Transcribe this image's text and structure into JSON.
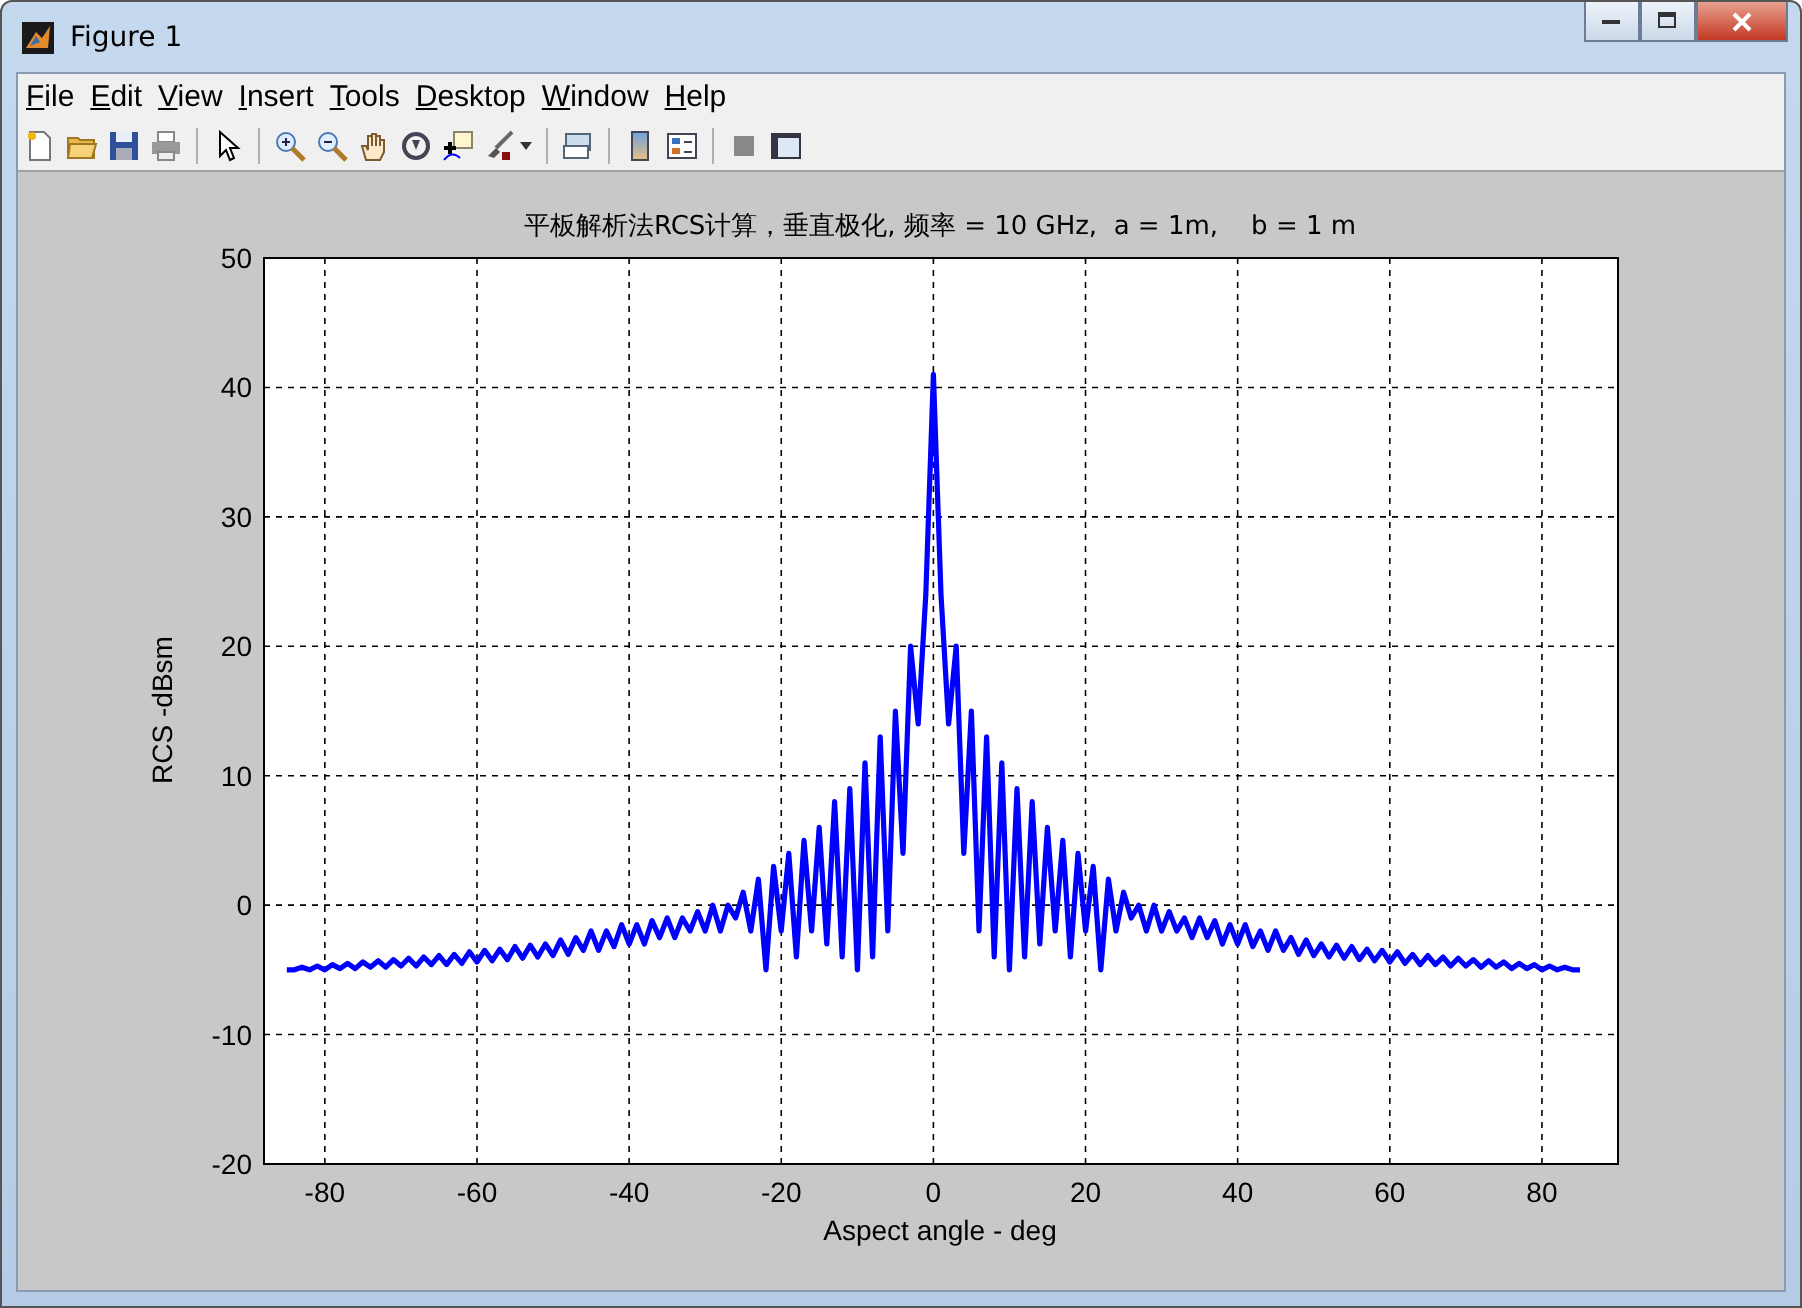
{
  "window": {
    "title": "Figure 1"
  },
  "menu": [
    "File",
    "Edit",
    "View",
    "Insert",
    "Tools",
    "Desktop",
    "Window",
    "Help"
  ],
  "figure": {
    "chart_data": {
      "type": "line",
      "title": "平板解析法RCS计算，垂直极化, 频率 = 10 GHz,  a = 1m,    b = 1 m",
      "xlabel": "Aspect angle - deg",
      "ylabel": "RCS -dBsm",
      "x": [
        -85,
        -84,
        -83,
        -82,
        -81,
        -80,
        -79,
        -78,
        -77,
        -76,
        -75,
        -74,
        -73,
        -72,
        -71,
        -70,
        -69,
        -68,
        -67,
        -66,
        -65,
        -64,
        -63,
        -62,
        -61,
        -60,
        -59,
        -58,
        -57,
        -56,
        -55,
        -54,
        -53,
        -52,
        -51,
        -50,
        -49,
        -48,
        -47,
        -46,
        -45,
        -44,
        -43,
        -42,
        -41,
        -40,
        -39,
        -38,
        -37,
        -36,
        -35,
        -34,
        -33,
        -32,
        -31,
        -30,
        -29,
        -28,
        -27,
        -26,
        -25,
        -24,
        -23,
        -22,
        -21,
        -20,
        -19,
        -18,
        -17,
        -16,
        -15,
        -14,
        -13,
        -12,
        -11,
        -10,
        -9,
        -8,
        -7,
        -6,
        -5,
        -4,
        -3,
        -2,
        -1,
        0,
        1,
        2,
        3,
        4,
        5,
        6,
        7,
        8,
        9,
        10,
        11,
        12,
        13,
        14,
        15,
        16,
        17,
        18,
        19,
        20,
        21,
        22,
        23,
        24,
        25,
        26,
        27,
        28,
        29,
        30,
        31,
        32,
        33,
        34,
        35,
        36,
        37,
        38,
        39,
        40,
        41,
        42,
        43,
        44,
        45,
        46,
        47,
        48,
        49,
        50,
        51,
        52,
        53,
        54,
        55,
        56,
        57,
        58,
        59,
        60,
        61,
        62,
        63,
        64,
        65,
        66,
        67,
        68,
        69,
        70,
        71,
        72,
        73,
        74,
        75,
        76,
        77,
        78,
        79,
        80,
        81,
        82,
        83,
        84,
        85
      ],
      "series": [
        {
          "color": "#0000ff",
          "values": [
            -5,
            -5,
            -4.8,
            -5,
            -4.7,
            -5,
            -4.6,
            -4.9,
            -4.5,
            -4.9,
            -4.4,
            -4.8,
            -4.3,
            -4.8,
            -4.2,
            -4.7,
            -4.1,
            -4.7,
            -4,
            -4.6,
            -3.9,
            -4.6,
            -3.8,
            -4.5,
            -3.6,
            -4.4,
            -3.5,
            -4.3,
            -3.4,
            -4.2,
            -3.2,
            -4.1,
            -3.1,
            -4,
            -3,
            -3.9,
            -2.7,
            -3.8,
            -2.5,
            -3.5,
            -2,
            -3.5,
            -2,
            -3.2,
            -1.5,
            -3,
            -1.5,
            -3,
            -1.2,
            -2.5,
            -1,
            -2.5,
            -1,
            -2,
            -0.5,
            -2,
            0,
            -2,
            0,
            -1,
            1,
            -2,
            2,
            -5,
            3,
            -2,
            4,
            -4,
            5,
            -2,
            6,
            -3,
            8,
            -4,
            9,
            -5,
            11,
            -4,
            13,
            -2,
            15,
            4,
            20,
            14,
            24,
            41,
            24,
            14,
            20,
            4,
            15,
            -2,
            13,
            -4,
            11,
            -5,
            9,
            -4,
            8,
            -3,
            6,
            -2,
            5,
            -4,
            4,
            -2,
            3,
            -5,
            2,
            -2,
            1,
            -1,
            0,
            -2,
            0,
            -2,
            -0.5,
            -2,
            -1,
            -2.5,
            -1,
            -2.5,
            -1.2,
            -3,
            -1.5,
            -3,
            -1.5,
            -3.2,
            -2,
            -3.5,
            -2,
            -3.5,
            -2.5,
            -3.8,
            -2.7,
            -3.9,
            -3,
            -4,
            -3.1,
            -4.1,
            -3.2,
            -4.2,
            -3.4,
            -4.3,
            -3.5,
            -4.4,
            -3.6,
            -4.5,
            -3.8,
            -4.6,
            -3.9,
            -4.6,
            -4,
            -4.7,
            -4.1,
            -4.7,
            -4.2,
            -4.8,
            -4.3,
            -4.8,
            -4.4,
            -4.9,
            -4.5,
            -4.9,
            -4.6,
            -5,
            -4.7,
            -5,
            -4.8,
            -5,
            -5
          ]
        }
      ],
      "xlim": [
        -88,
        90
      ],
      "ylim": [
        -20,
        50
      ],
      "xticks": [
        -80,
        -60,
        -40,
        -20,
        0,
        20,
        40,
        60,
        80
      ],
      "yticks": [
        -20,
        -10,
        0,
        10,
        20,
        30,
        40,
        50
      ],
      "grid": true
    }
  }
}
